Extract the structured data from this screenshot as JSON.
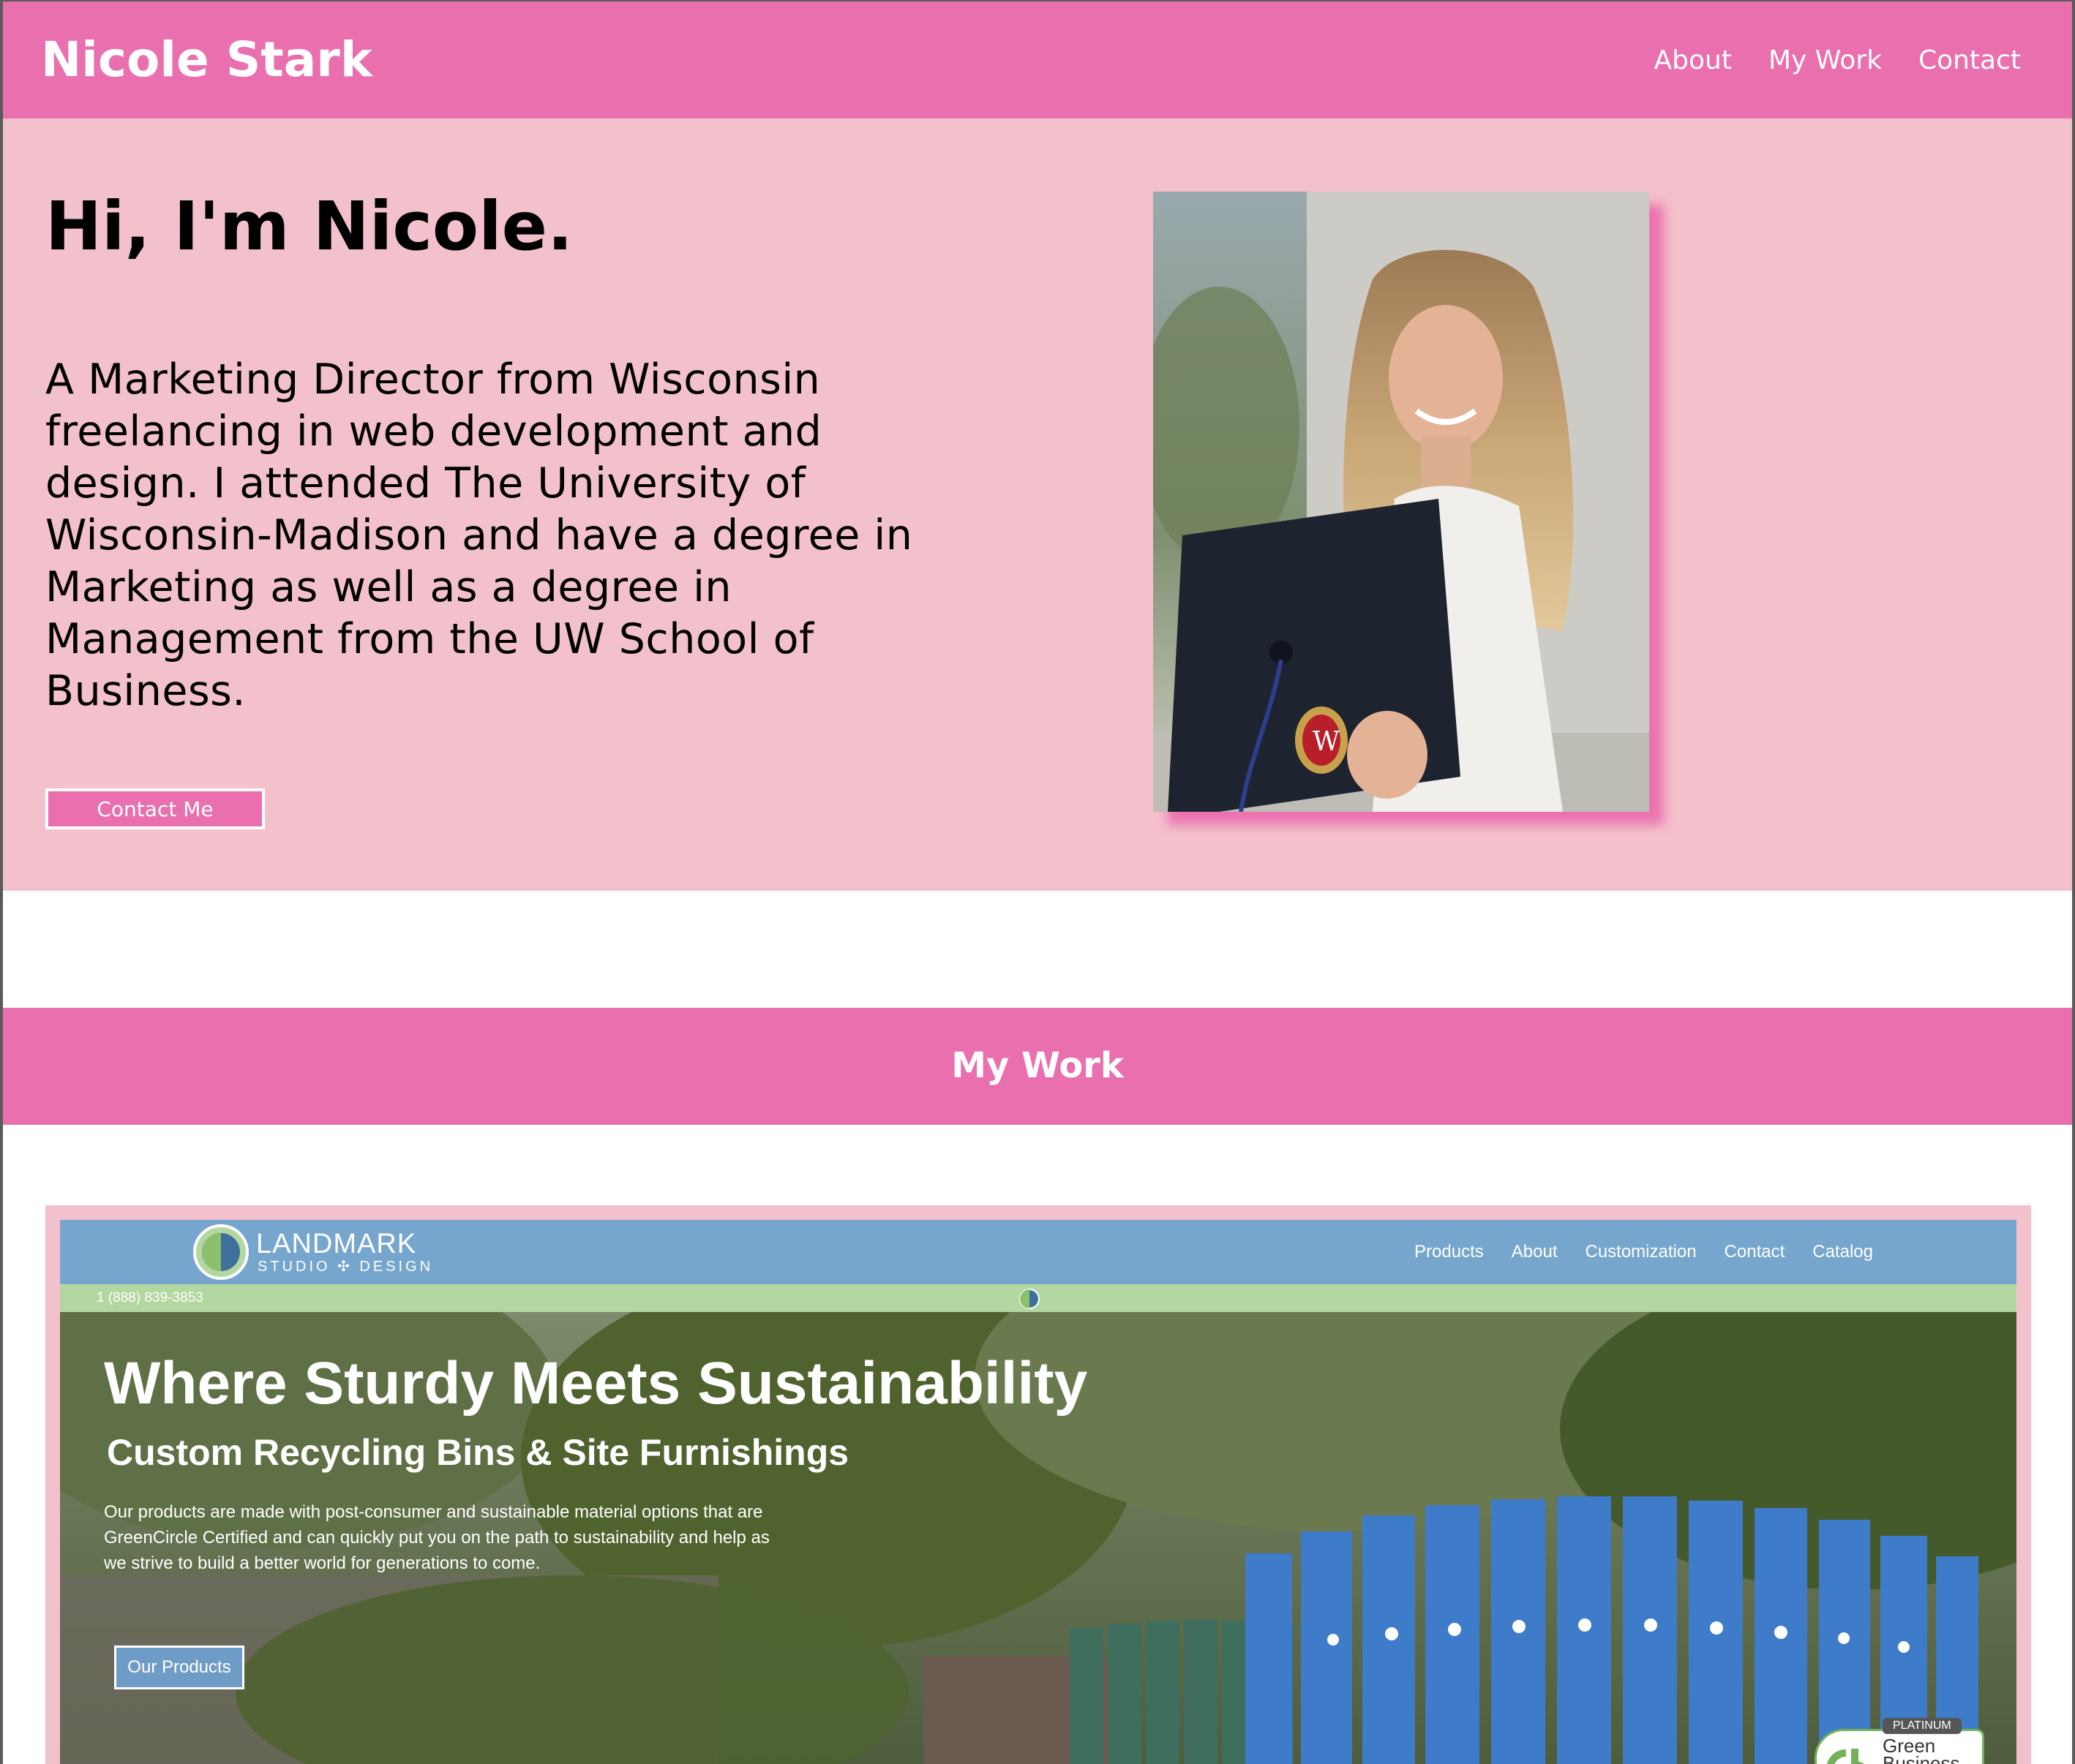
{
  "header": {
    "brand": "Nicole Stark",
    "nav": [
      "About",
      "My Work",
      "Contact"
    ]
  },
  "hero": {
    "title": "Hi, I'm Nicole.",
    "bio": "A Marketing Director from Wisconsin freelancing in web development and design. I attended The University of Wisconsin-Madison and have a degree in Marketing as well as a degree in Management from the UW School of Business.",
    "contact_button": "Contact Me",
    "portrait_alt": "Nicole holding a graduation cap"
  },
  "work": {
    "title": "My Work",
    "project": {
      "logo_name": "LANDMARK",
      "logo_sub": "STUDIO ✣ DESIGN",
      "nav": [
        "Products",
        "About",
        "Customization",
        "Contact",
        "Catalog"
      ],
      "phone": "1 (888) 839-3853",
      "headline": "Where Sturdy Meets Sustainability",
      "subheadline": "Custom Recycling Bins & Site Furnishings",
      "description": "Our products are made with post-consumer and sustainable material options that are GreenCircle Certified and can quickly put you on the path to sustainability and help as we strive to build a better world for generations to come.",
      "button": "Our Products",
      "badge_tag": "PLATINUM",
      "badge_text": "Green\nBusiness\nBureau"
    }
  },
  "colors": {
    "accent_pink": "#ea6fae",
    "soft_pink": "#f3c1cb",
    "landmark_blue": "#76a6ce",
    "landmark_green": "#b3d7a0"
  }
}
